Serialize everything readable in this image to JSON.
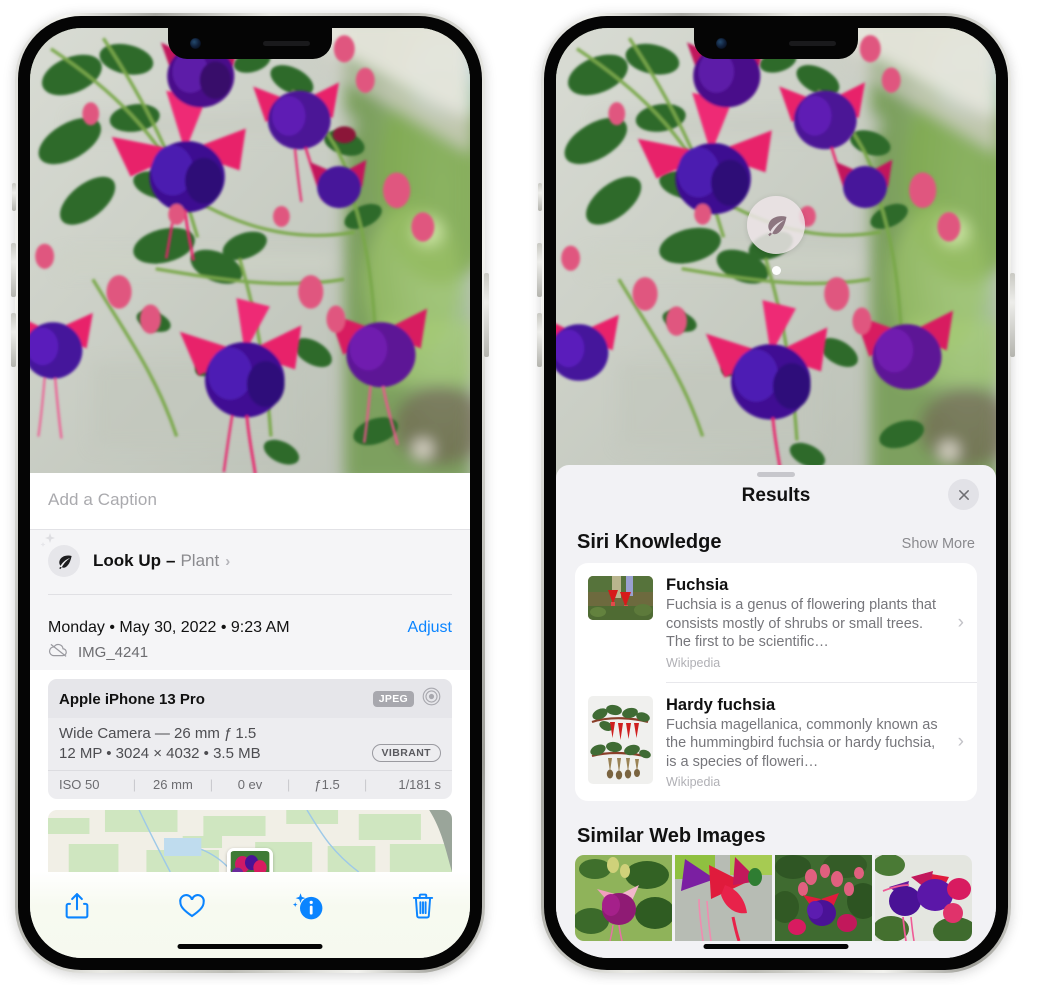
{
  "left_phone": {
    "caption_placeholder": "Add a Caption",
    "lookup": {
      "label": "Look Up",
      "dash": "–",
      "subject": "Plant",
      "chevron": "›",
      "icon": "leaf-icon"
    },
    "meta": {
      "date": "Monday • May 30, 2022 • 9:23 AM",
      "adjust_label": "Adjust",
      "filename": "IMG_4241",
      "cloud_icon": "icloud-slash-icon"
    },
    "exif": {
      "device": "Apple iPhone 13 Pro",
      "format_badge": "JPEG",
      "hdr_icon": "concentric-circles-icon",
      "lens_line": "Wide Camera — 26 mm ƒ 1.5",
      "size_line": "12 MP • 3024 × 4032 • 3.5 MB",
      "style_badge": "VIBRANT",
      "settings": [
        "ISO 50",
        "26 mm",
        "0 ev",
        "ƒ1.5",
        "1/181 s"
      ]
    },
    "toolbar": [
      {
        "name": "share-button",
        "icon": "share-icon"
      },
      {
        "name": "favorite-button",
        "icon": "heart-icon"
      },
      {
        "name": "info-button",
        "icon": "info-sparkle-icon"
      },
      {
        "name": "delete-button",
        "icon": "trash-icon"
      }
    ]
  },
  "right_phone": {
    "leaf_badge_icon": "leaf-icon",
    "sheet": {
      "title": "Results",
      "close_icon": "close-icon",
      "sections": [
        {
          "heading": "Siri Knowledge",
          "action": "Show More",
          "items": [
            {
              "title": "Fuchsia",
              "description": "Fuchsia is a genus of flowering plants that consists mostly of shrubs or small trees. The first to be scientific…",
              "source": "Wikipedia",
              "thumb": "fuchsia-red-flowers-thumb"
            },
            {
              "title": "Hardy fuchsia",
              "description": "Fuchsia magellanica, commonly known as the hummingbird fuchsia or hardy fuchsia, is a species of floweri…",
              "source": "Wikipedia",
              "thumb": "hardy-fuchsia-specimen-thumb"
            }
          ]
        },
        {
          "heading": "Similar Web Images",
          "images": [
            "fuchsia-web-image-1",
            "fuchsia-web-image-2",
            "fuchsia-web-image-3",
            "fuchsia-web-image-4"
          ]
        }
      ]
    }
  },
  "colors": {
    "accent_blue": "#0a84ff",
    "sheet_bg": "#f2f2f5",
    "card_bg": "#ffffff",
    "secondary_text": "#8a8a8e"
  }
}
